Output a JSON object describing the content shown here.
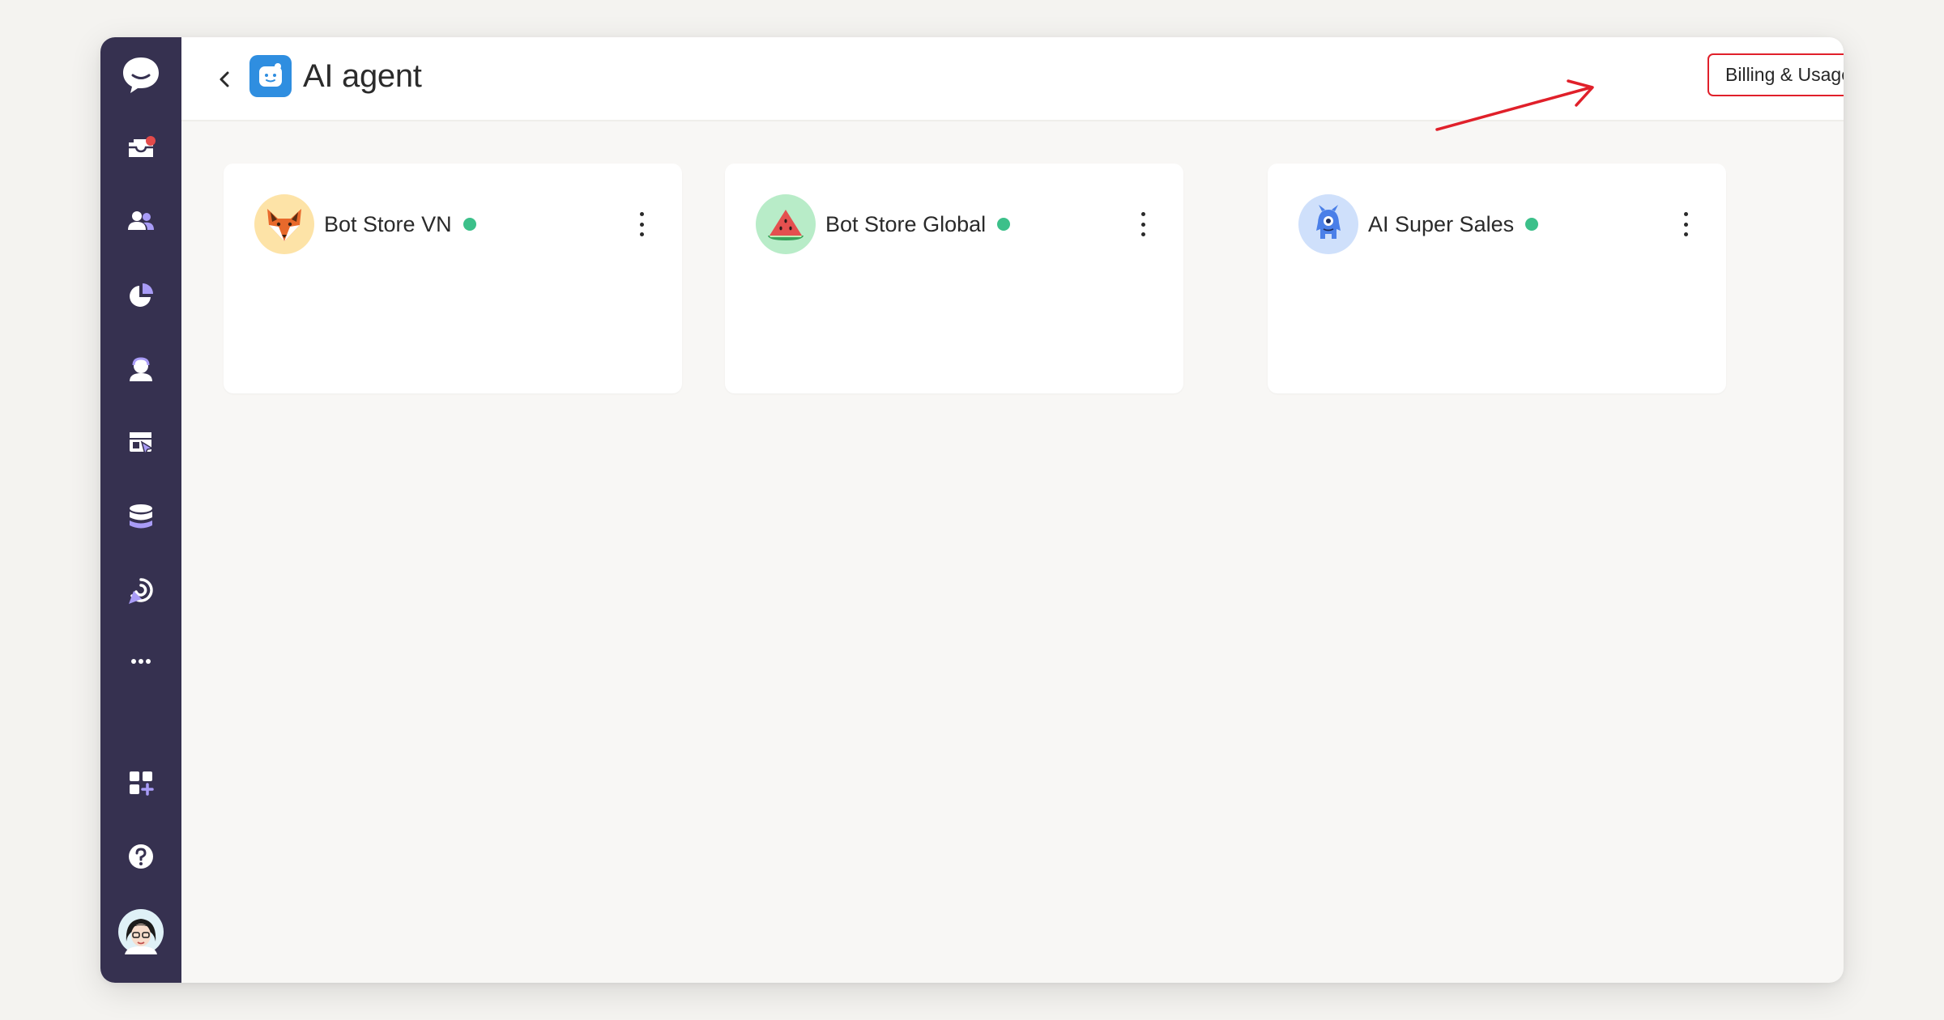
{
  "header": {
    "title": "AI agent",
    "billing_label": "Billing & Usage"
  },
  "sidebar": {
    "top_items": [
      {
        "icon": "chat-logo-icon"
      },
      {
        "icon": "inbox-icon",
        "has_notification": true
      },
      {
        "icon": "contacts-icon"
      },
      {
        "icon": "reports-pie-icon"
      },
      {
        "icon": "agent-icon"
      },
      {
        "icon": "widget-icon"
      },
      {
        "icon": "database-icon"
      },
      {
        "icon": "campaign-icon"
      },
      {
        "icon": "more-icon"
      }
    ],
    "bottom_items": [
      {
        "icon": "apps-grid-icon"
      },
      {
        "icon": "help-icon"
      },
      {
        "icon": "user-avatar"
      }
    ]
  },
  "agents": [
    {
      "name": "Bot Store VN",
      "avatar": "fox-icon",
      "status_color": "#3cc08a",
      "avatar_bg": "#fde3a7"
    },
    {
      "name": "Bot Store Global",
      "avatar": "watermelon-icon",
      "status_color": "#3cc08a",
      "avatar_bg": "#b8ecc8"
    },
    {
      "name": "AI Super Sales",
      "avatar": "monster-icon",
      "status_color": "#3cc08a",
      "avatar_bg": "#cfe0fb"
    }
  ],
  "colors": {
    "sidebar_bg": "#363150",
    "accent_purple": "#8b7cf6",
    "annotation_red": "#e0202a"
  }
}
